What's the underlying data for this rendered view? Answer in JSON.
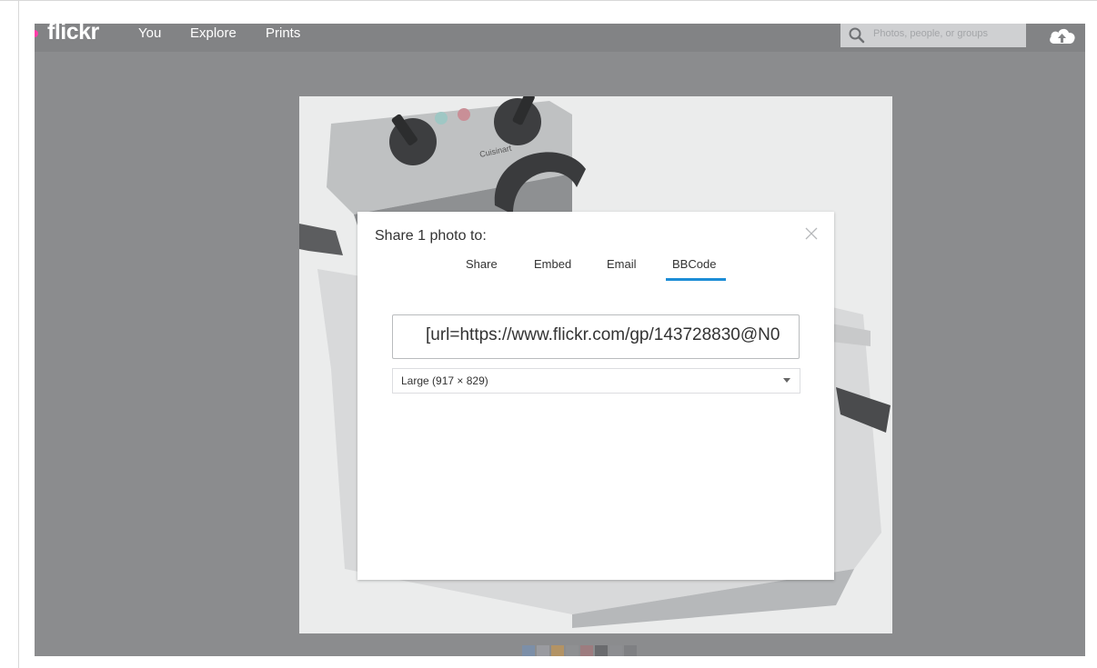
{
  "brand": {
    "logo_text": "flickr",
    "dot_color": "#ff3da8"
  },
  "nav": {
    "links": [
      "You",
      "Explore",
      "Prints"
    ],
    "search_placeholder": "Photos, people, or groups",
    "search_icon": "search-icon",
    "upload_icon": "cloud-upload-icon"
  },
  "photo": {
    "brand_text": "Cuisinart"
  },
  "share_modal": {
    "title": "Share 1 photo to:",
    "tabs": [
      {
        "label": "Share",
        "active": false
      },
      {
        "label": "Embed",
        "active": false
      },
      {
        "label": "Email",
        "active": false
      },
      {
        "label": "BBCode",
        "active": true
      }
    ],
    "active_tab_color": "#1d8dd6",
    "code_value": "[url=https://www.flickr.com/gp/143728830@N0",
    "size_selected": "Large (917 × 829)",
    "close_icon": "close-icon"
  }
}
